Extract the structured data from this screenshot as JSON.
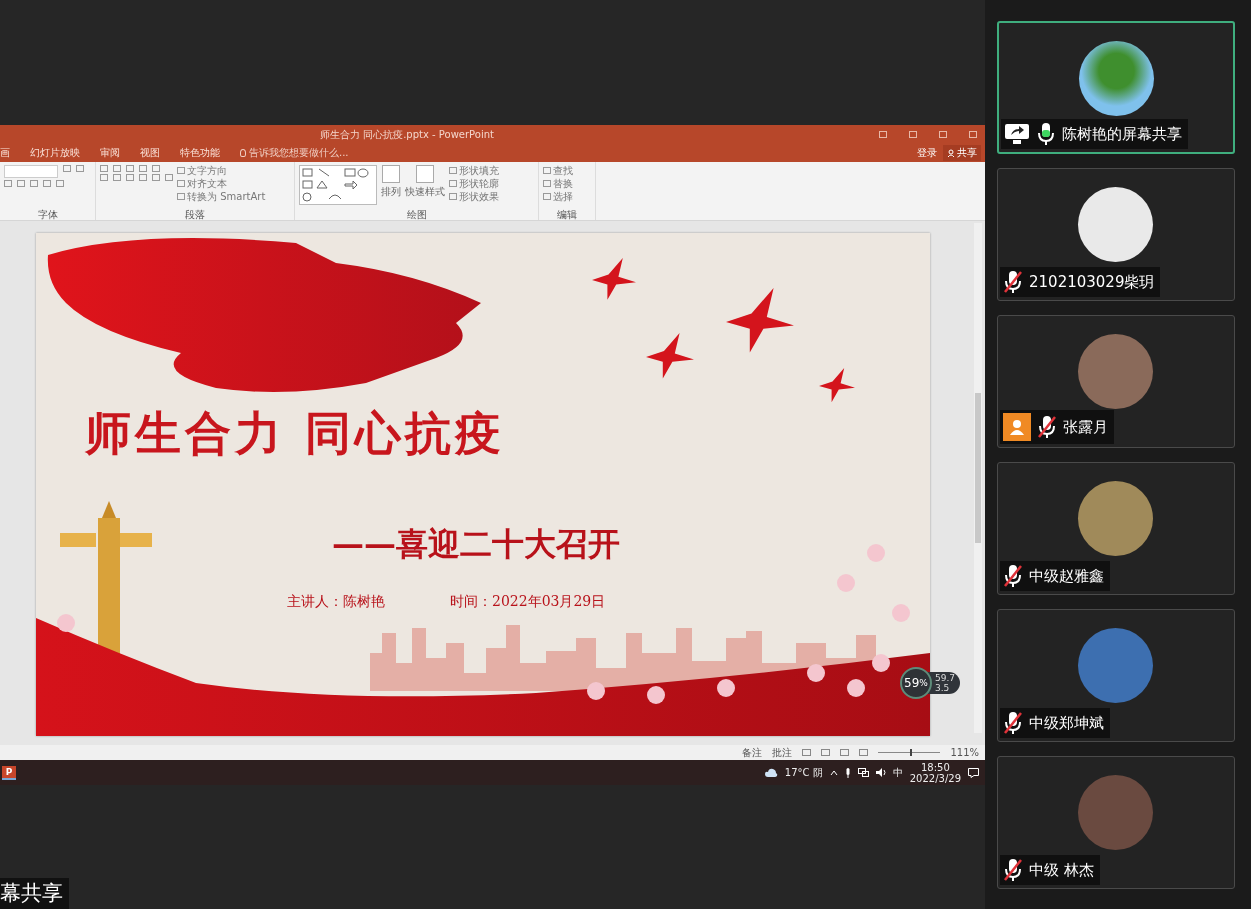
{
  "powerpoint": {
    "title": "师生合力 同心抗疫.pptx - PowerPoint",
    "menu_tabs": [
      "画",
      "幻灯片放映",
      "审阅",
      "视图",
      "特色功能"
    ],
    "tell_me": "告诉我您想要做什么...",
    "sign_in": "登录",
    "share": "共享",
    "ribbon_groups": [
      {
        "label": "字体",
        "kind": "font"
      },
      {
        "label": "段落",
        "kind": "paragraph",
        "commands": [
          "文字方向",
          "对齐文本",
          "转换为 SmartArt"
        ]
      },
      {
        "label": "绘图",
        "kind": "drawing",
        "commands": [
          "排列",
          "快速样式",
          "形状填充",
          "形状轮廓",
          "形状效果"
        ]
      },
      {
        "label": "编辑",
        "kind": "editing",
        "commands": [
          "查找",
          "替换",
          "选择"
        ]
      }
    ],
    "slide": {
      "title": "师生合力 同心抗疫",
      "subtitle": "——喜迎二十大召开",
      "presenter": "主讲人：陈树艳",
      "date": "时间：2022年03月29日"
    },
    "status_bar": {
      "notes": "备注",
      "comments": "批注",
      "zoom": "111%",
      "zoom_slider": {
        "level": 0.52
      }
    }
  },
  "taskbar": {
    "app_letter": "P",
    "weather": "17°C 阴",
    "ime": "中",
    "time": "18:50",
    "date": "2022/3/29"
  },
  "net_meter": {
    "percent": "59",
    "unit": "%",
    "upload": "59.7",
    "download": "3.5"
  },
  "participants": [
    {
      "name": "陈树艳的屏幕共享",
      "selected": true,
      "muted": false,
      "sharing": true,
      "guest_badge": false
    },
    {
      "name": "2102103029柴玥",
      "selected": false,
      "muted": true,
      "sharing": false,
      "guest_badge": false
    },
    {
      "name": "张露月",
      "selected": false,
      "muted": true,
      "sharing": false,
      "guest_badge": true
    },
    {
      "name": "中级赵雅鑫",
      "selected": false,
      "muted": true,
      "sharing": false,
      "guest_badge": false
    },
    {
      "name": "中级郑坤斌",
      "selected": false,
      "muted": true,
      "sharing": false,
      "guest_badge": false
    },
    {
      "name": "中级 林杰",
      "selected": false,
      "muted": true,
      "sharing": false,
      "guest_badge": false
    }
  ],
  "share_caption": "幕共享"
}
